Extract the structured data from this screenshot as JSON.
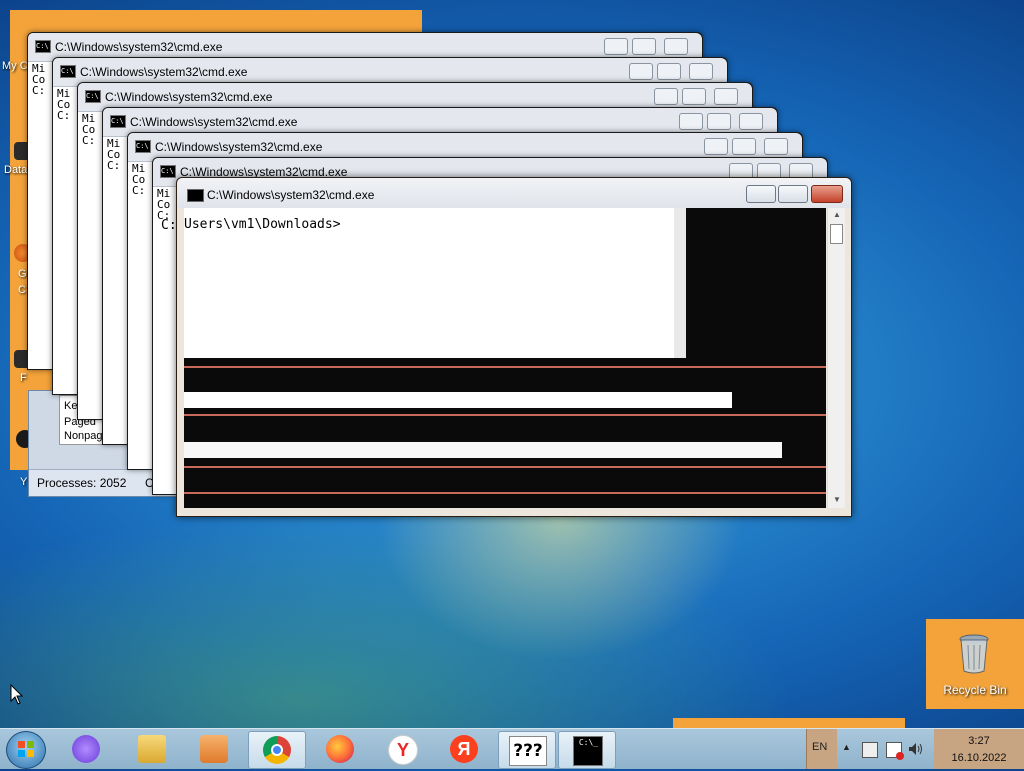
{
  "desktop": {
    "icon_labels": [
      "My C",
      "Data",
      "G",
      "C",
      "F",
      "Y"
    ],
    "recycle_bin": {
      "label": "Recycle Bin",
      "icon": "recycle-bin-icon"
    }
  },
  "task_manager": {
    "lines": [
      "Ke",
      "Paged",
      "Nonpag"
    ],
    "processes": "Processes: 2052",
    "cut": "C"
  },
  "cmd_windows": {
    "title": "C:\\Windows\\system32\\cmd.exe",
    "left_text": [
      "Mi",
      "Co",
      "",
      "C:"
    ],
    "front_prompt": "Users\\vm1\\Downloads>",
    "front_left": "C:"
  },
  "taskbar": {
    "items": [
      {
        "name": "start-button",
        "icon": "windows-logo-icon"
      },
      {
        "name": "alice-assistant",
        "icon": "alice-icon"
      },
      {
        "name": "file-explorer",
        "icon": "folder-icon"
      },
      {
        "name": "media-player",
        "icon": "media-player-icon"
      },
      {
        "name": "chrome",
        "icon": "chrome-icon"
      },
      {
        "name": "firefox",
        "icon": "firefox-icon"
      },
      {
        "name": "yandex-browser",
        "icon": "yandex-browser-icon"
      },
      {
        "name": "yandex",
        "icon": "yandex-icon"
      },
      {
        "name": "unknown-app",
        "icon": "question-marks-icon",
        "text": "???"
      },
      {
        "name": "cmd",
        "icon": "cmd-icon"
      }
    ],
    "language": "EN",
    "time": "3:27",
    "date": "16.10.2022"
  },
  "colors": {
    "desktop_orange": "#f3a33a",
    "wallpaper_blue": "#1565b6",
    "title_close_red": "#c4412a"
  }
}
